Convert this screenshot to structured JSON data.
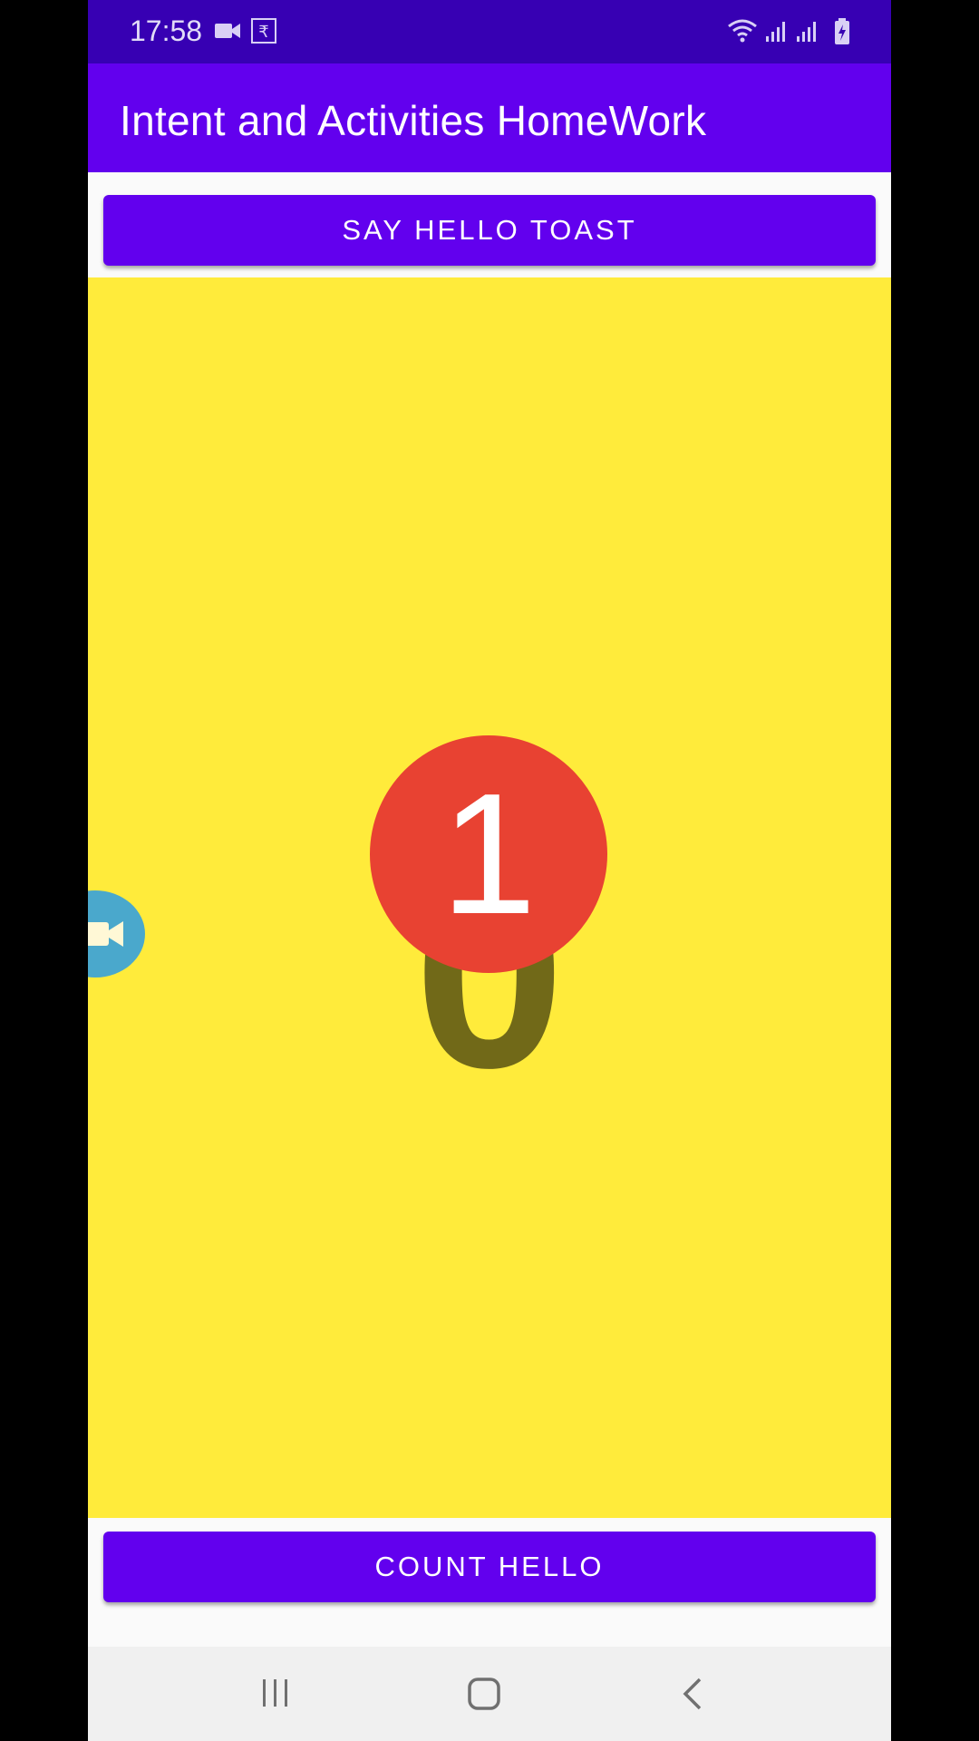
{
  "status_bar": {
    "time": "17:58",
    "icons": [
      "video-camera-icon",
      "rupee-sign-icon",
      "wifi-icon",
      "signal-icon",
      "signal-icon",
      "battery-icon"
    ],
    "rupee_glyph": "₹"
  },
  "app_bar": {
    "title": "Intent and Activities HomeWork"
  },
  "main": {
    "toast_button_label": "SAY HELLO TOAST",
    "count_value": "0",
    "count_button_label": "COUNT HELLO",
    "count_area_color": "#ffeb3b"
  },
  "notification_badge": {
    "value": "1",
    "color": "#e84232"
  },
  "floating_bubble": {
    "icon": "video-camera-icon",
    "color": "#4aa8cc"
  },
  "nav_bar": {
    "icons": [
      "recent-apps-icon",
      "home-icon",
      "back-icon"
    ]
  },
  "colors": {
    "primary": "#6200ee",
    "primary_dark": "#3700b3"
  }
}
